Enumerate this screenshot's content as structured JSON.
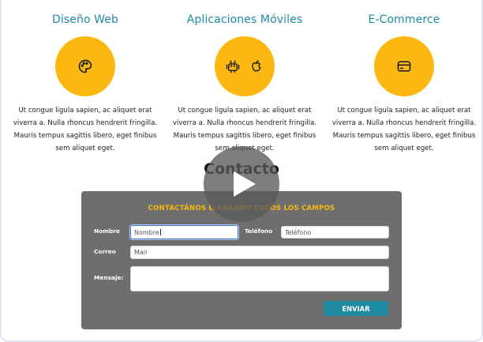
{
  "services": [
    {
      "title": "Diseño Web",
      "icon": "palette-icon",
      "description": "Ut congue ligula sapien, ac aliquet erat viverra a. Nulla rhoncus hendrerit fringilla. Mauris tempus sagittis libero, eget finibus sem aliquet eget."
    },
    {
      "title": "Aplicaciones Móviles",
      "icon": "android-apple-icons",
      "description": "Ut congue ligula sapien, ac aliquet erat viverra a. Nulla rhoncus hendrerit fringilla. Mauris tempus sagittis libero, eget finibus sem aliquet eget."
    },
    {
      "title": "E-Commerce",
      "icon": "credit-card-icon",
      "description": "Ut congue ligula sapien, ac aliquet erat viverra a. Nulla rhoncus hendrerit fringilla. Mauris tempus sagittis libero, eget finibus sem aliquet eget."
    }
  ],
  "contact": {
    "title": "Contacto",
    "heading": "CONTACTÁNOS LLENANDO TODOS LOS CAMPOS",
    "name_label": "Nombre",
    "name_placeholder": "Nombre",
    "phone_label": "Teléfono",
    "phone_placeholder": "Teléfono",
    "email_label": "Correo",
    "email_placeholder": "Mail",
    "message_label": "Mensaje:",
    "submit_label": "ENVIAR"
  },
  "colors": {
    "accent_yellow": "#fcb810",
    "title_teal": "#1f8aa8",
    "panel_gray": "#6e6e6e",
    "button_teal": "#1f8aa0"
  }
}
